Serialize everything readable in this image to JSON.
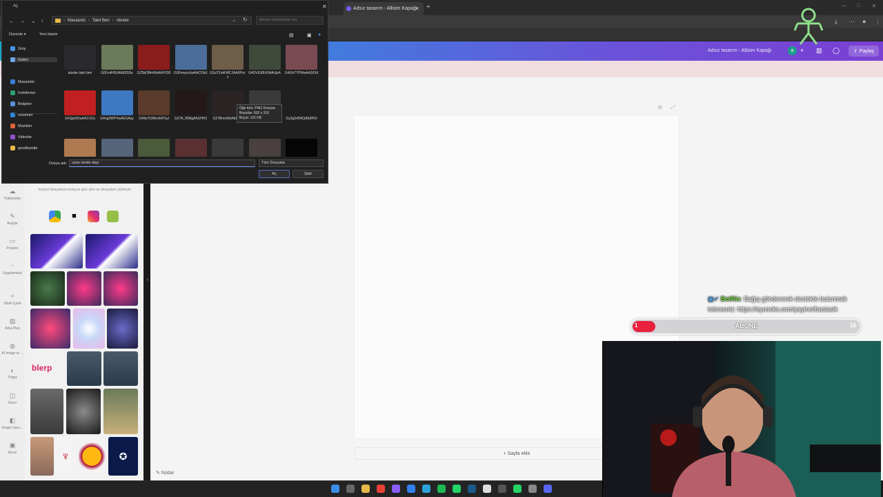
{
  "browser": {
    "tab_title": "Adsız tasarım - Albüm Kapağı"
  },
  "canva": {
    "doc_title": "Adsız tasarım - Albüm Kapağı",
    "avatar_letter": "a",
    "share_label": "Paylaş",
    "rail_items": [
      "Yüklemeler",
      "Araçlar",
      "Projeler",
      "Uygulamalar",
      "Sihirli İçerik",
      "Arka Plan",
      "AI Image to ...",
      "Trippy",
      "Borsi",
      "Image Upsc...",
      "Ekran"
    ],
    "panel_text": "kişisel dosyalara kolayca göz atın ve dosyaları yükleyin",
    "blerp_label": "blerp",
    "add_page_label": "+ Sayfa ekle",
    "notes_label": "Notlar"
  },
  "dialog": {
    "title": "Aç",
    "path": [
      "Masaüstü",
      "Takıl Beri",
      "Aloske"
    ],
    "search_placeholder": "Aloske klasöründe ara",
    "toolbar_organize": "Düzenle ▾",
    "toolbar_new_folder": "Yeni klasör",
    "nav_items": [
      {
        "label": "Giriş",
        "color": "#4a90e2"
      },
      {
        "label": "Galeri",
        "color": "#6aa6e8"
      },
      {
        "label": "Masaüstü",
        "color": "#3b7dd8"
      },
      {
        "label": "İndirilenler",
        "color": "#2f9e6e"
      },
      {
        "label": "Belgeler",
        "color": "#5b8ed6"
      },
      {
        "label": "Resimler",
        "color": "#2d8ad8"
      },
      {
        "label": "Müzikler",
        "color": "#e0623c"
      },
      {
        "label": "Videolar",
        "color": "#8c52c9"
      },
      {
        "label": "goodbyedpi",
        "color": "#e6b84a"
      }
    ],
    "files": [
      {
        "label": "aloske takıl beri",
        "color": "#2a2a2e"
      },
      {
        "label": "G0Fz4H5XAAE8S9u",
        "color": "#6b7a5a"
      },
      {
        "label": "GZ5bDBmWsAAY030",
        "color": "#8a1c1c"
      },
      {
        "label": "G3FmvpsXwAACObX",
        "color": "#4c6d9a"
      },
      {
        "label": "G3uTZmKWCJAA9Pvcz",
        "color": "#6e5e48"
      },
      {
        "label": "G4DVEXBX0AAUjzA",
        "color": "#3f4a3a"
      },
      {
        "label": "G4Gh77PWwAA1fOd",
        "color": "#7a4a52"
      },
      {
        "label": "G4Jjjef3XaAA1OZa",
        "color": "#c02020"
      },
      {
        "label": "G4ng3WPXwAEXAay",
        "color": "#3d78c2"
      },
      {
        "label": "G4NoTc9WcAAThyt",
        "color": "#5a3a2a"
      },
      {
        "label": "G27A_f6WgAAUHH1",
        "color": "#241818"
      },
      {
        "label": "G27BmoWkAEE9P",
        "color": "#2c2424"
      },
      {
        "label": "G27NDGKXIAEINXR",
        "color": "#3a3a3a"
      },
      {
        "label": "Gy2g3r8WQAE8PUl",
        "color": "#202020"
      },
      {
        "label": "",
        "color": "#b07a50"
      },
      {
        "label": "",
        "color": "#55657a"
      },
      {
        "label": "",
        "color": "#4a5a3a"
      },
      {
        "label": "",
        "color": "#5a3030"
      },
      {
        "label": "",
        "color": "#3a3a3a"
      },
      {
        "label": "",
        "color": "#4a4040"
      },
      {
        "label": "",
        "color": "#050505"
      }
    ],
    "tooltip_lines": [
      "Öğe türü: PNG Dosyası",
      "Boyutlar: 692 x 316",
      "Boyut: 131 KB"
    ],
    "filename_label": "Dosya adı:",
    "filename_value": "uzan nerde dayı",
    "filetype_value": "Tüm Dosyalar",
    "open_label": "Aç",
    "cancel_label": "İptal"
  },
  "overlay": {
    "bot_name": "BotRix",
    "donate_line1": ": Bağış göndererek destekte bulunmak",
    "donate_line2": "isterseniz: https://oyuneks.com/yayinci/basiacik",
    "sub_current": "1",
    "sub_label": "ABONE",
    "sub_goal": "10",
    "sub_progress": 0.1,
    "accent": "#e8213f"
  },
  "taskbar": {
    "icons": [
      {
        "name": "windows-start-icon",
        "color": "#3a8ee6"
      },
      {
        "name": "search-icon",
        "color": "#666"
      },
      {
        "name": "file-explorer-icon",
        "color": "#e6b84a"
      },
      {
        "name": "chrome-icon",
        "color": "#e94235"
      },
      {
        "name": "opera-gx-icon",
        "color": "#8b5cf6"
      },
      {
        "name": "vscode-icon",
        "color": "#2f80ed"
      },
      {
        "name": "telegram-icon",
        "color": "#2aa4d8"
      },
      {
        "name": "spotify-icon",
        "color": "#1db954"
      },
      {
        "name": "whatsapp-app-icon",
        "color": "#25d366"
      },
      {
        "name": "steam-icon",
        "color": "#1b5a8a"
      },
      {
        "name": "capcut-icon",
        "color": "#ddd"
      },
      {
        "name": "obs-icon",
        "color": "#555"
      },
      {
        "name": "whatsapp-icon",
        "color": "#25d366"
      },
      {
        "name": "game-icon",
        "color": "#888"
      },
      {
        "name": "discord-icon",
        "color": "#5865f2"
      }
    ]
  }
}
